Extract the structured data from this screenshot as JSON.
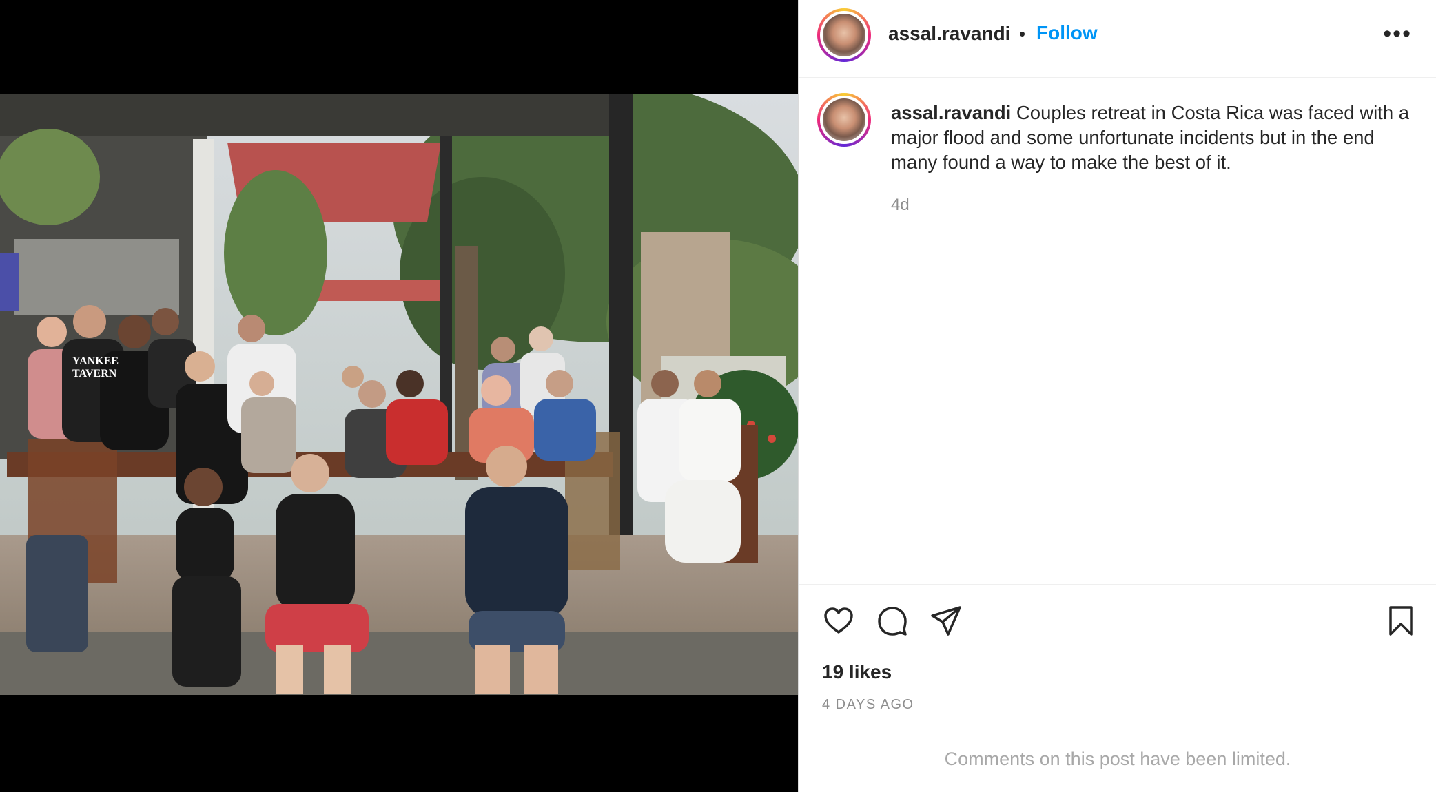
{
  "post": {
    "username": "assal.ravandi",
    "separator": "•",
    "follow_label": "Follow",
    "more_label": "•••",
    "caption_user": "assal.ravandi",
    "caption_text": " Couples retreat in Costa Rica was faced with a major flood and some unfortunate incidents but in the end many found a way to make the best of it.",
    "time_ago": "4d",
    "likes": "19 likes",
    "date": "4 DAYS AGO",
    "comments_notice": "Comments on this post have been limited."
  },
  "photo": {
    "shirt_text_line1": "YANKEE",
    "shirt_text_line2": "TAVERN"
  },
  "icons": {
    "like": "heart-icon",
    "comment": "comment-icon",
    "share": "send-icon",
    "save": "bookmark-icon",
    "more": "more-options-icon"
  },
  "colors": {
    "follow": "#0095f6",
    "text": "#262626",
    "muted": "#8e8e8e",
    "limited": "#a8a8a8"
  }
}
